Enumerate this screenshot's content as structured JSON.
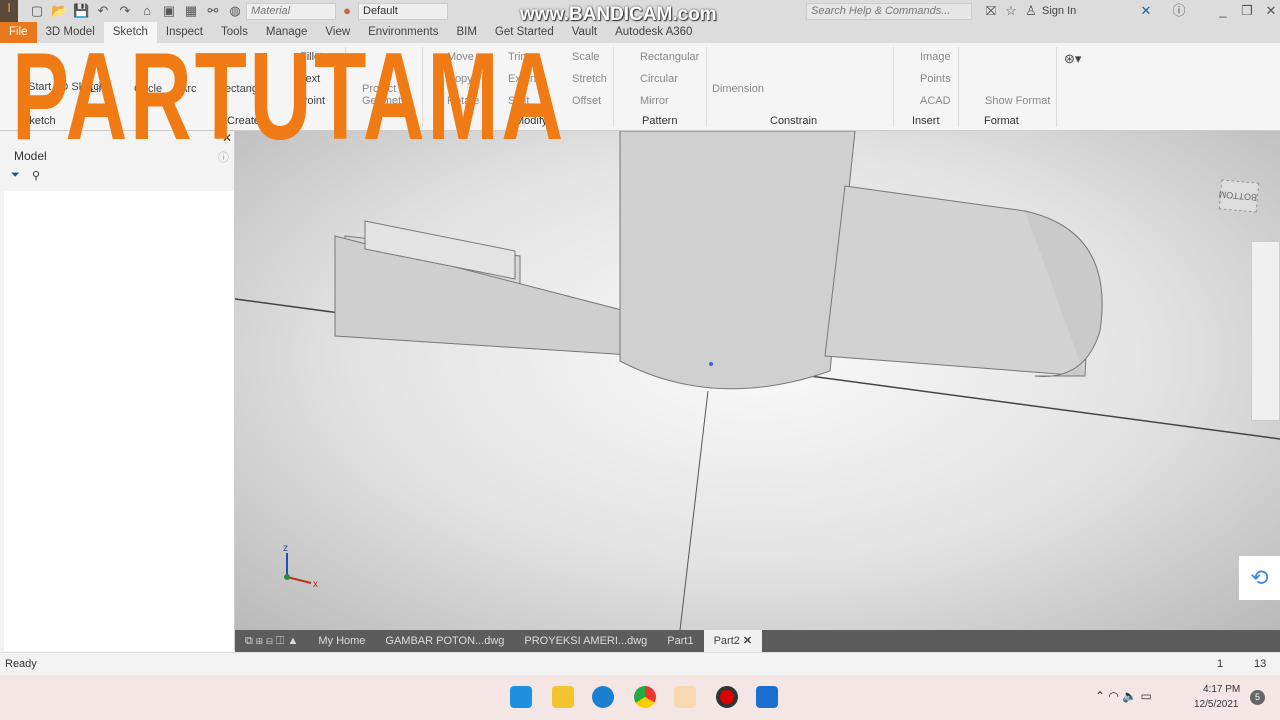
{
  "qat": {
    "material": "Material",
    "appearance": "Default",
    "search_placeholder": "Search Help & Commands...",
    "sign_in": "Sign In"
  },
  "watermark": "www.BANDICAM.com",
  "tabs": [
    "File",
    "3D Model",
    "Sketch",
    "Inspect",
    "Tools",
    "Manage",
    "View",
    "Environments",
    "BIM",
    "Get Started",
    "Vault",
    "Autodesk A360"
  ],
  "active_tab": "Sketch",
  "ribbon": {
    "sketch": {
      "start": "Start 2D Sketch",
      "label": "Sketch"
    },
    "create": {
      "line": "Line",
      "circle": "Circle",
      "arc": "Arc",
      "rectangle": "Rectangle",
      "fillet": "Fillet",
      "text": "Text",
      "point": "Point",
      "label": "Create"
    },
    "project": "Project Geometry",
    "modify": {
      "move": "Move",
      "copy": "Copy",
      "rotate": "Rotate",
      "trim": "Trim",
      "extend": "Extend",
      "split": "Split",
      "scale": "Scale",
      "stretch": "Stretch",
      "offset": "Offset",
      "label": "Modify"
    },
    "pattern": {
      "rectangular": "Rectangular",
      "circular": "Circular",
      "mirror": "Mirror",
      "label": "Pattern"
    },
    "constrain": {
      "dimension": "Dimension",
      "label": "Constrain"
    },
    "insert": {
      "image": "Image",
      "points": "Points",
      "acad": "ACAD",
      "label": "Insert"
    },
    "format": {
      "show_format": "Show Format",
      "label": "Format"
    }
  },
  "browser": {
    "title": "Model"
  },
  "viewcube": "BOTTOM",
  "doc_tabs": [
    "My Home",
    "GAMBAR POTON...dwg",
    "PROYEKSI AMERI...dwg",
    "Part1",
    "Part2"
  ],
  "active_doc": "Part2",
  "status": {
    "text": "Ready",
    "count1": "1",
    "count2": "13"
  },
  "taskbar": {
    "time": "4:17 PM",
    "date": "12/5/2021",
    "badge": "5"
  },
  "overlay_title": "PARTUTAMA",
  "colors": {
    "accent": "#e8781b",
    "overlay": "#f07a14"
  }
}
